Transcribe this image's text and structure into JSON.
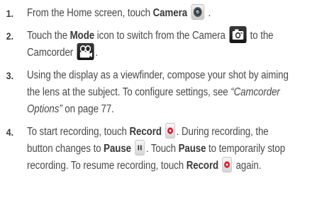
{
  "steps": [
    {
      "number": "1.",
      "t1": "From the Home screen, touch ",
      "b1": "Camera",
      "t2": " ."
    },
    {
      "number": "2.",
      "t1": "Touch the ",
      "b1": "Mode",
      "t2": " icon to switch from the Camera ",
      "t3": " to the Camcorder ",
      "t4": "."
    },
    {
      "number": "3.",
      "t1": "Using the display as a viewfinder, compose your shot by aiming the lens at the subject. To configure settings, see ",
      "i1": "“Camcorder Options”",
      "t2": " on page 77."
    },
    {
      "number": "4.",
      "t1": "To start recording, touch ",
      "b1": "Record",
      "t2": ". During recording, the button changes to ",
      "b2": "Pause",
      "t3": ". Touch ",
      "b3": "Pause",
      "t4": " to temporarily stop recording. To resume recording, touch ",
      "b4": "Record",
      "t5": " again."
    }
  ],
  "icons": {
    "camera_app": "camera-app-icon",
    "camera_mode": "camera-mode-icon",
    "camcorder_mode": "camcorder-mode-icon",
    "record": "record-icon",
    "pause": "pause-icon"
  },
  "colors": {
    "text": "#4a4a4a",
    "step_number": "#3b3b3b",
    "record_red": "#e0192a",
    "mode_icon_bg": "#1e1e1e"
  }
}
